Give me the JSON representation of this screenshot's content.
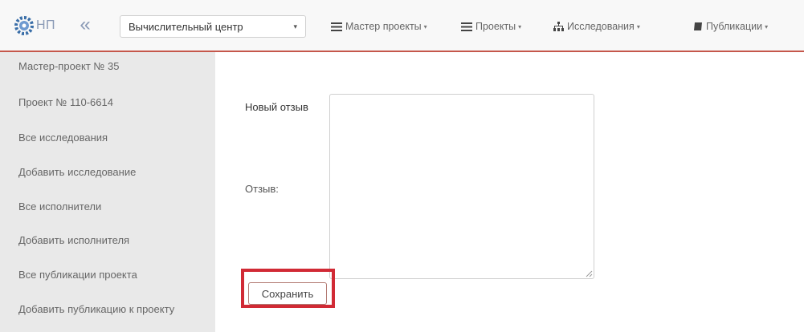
{
  "navbar": {
    "logo_text": "НП",
    "collapse_glyph": "«",
    "center_select": {
      "value": "Вычислительный центр",
      "caret": "▾"
    },
    "menus": [
      {
        "label": "Мастер проекты",
        "icon": "list-icon"
      },
      {
        "label": "Проекты",
        "icon": "list-icon"
      },
      {
        "label": "Исследования",
        "icon": "sitemap-icon"
      },
      {
        "label": "Публикации",
        "icon": "book-icon"
      }
    ],
    "accent_color": "#c5574b"
  },
  "sidebar": {
    "items": [
      {
        "label": "Мастер-проект № 35"
      },
      {
        "label": "Проект № 110-6614"
      },
      {
        "label": "Все исследования"
      },
      {
        "label": "Добавить исследование"
      },
      {
        "label": "Все исполнители"
      },
      {
        "label": "Добавить исполнителя"
      },
      {
        "label": "Все публикации проекта"
      },
      {
        "label": "Добавить публикацию к проекту"
      }
    ]
  },
  "form": {
    "title": "Новый отзыв",
    "review_label": "Отзыв:",
    "review_value": "",
    "save_label": "Сохранить",
    "highlight_color": "#d12a35"
  }
}
